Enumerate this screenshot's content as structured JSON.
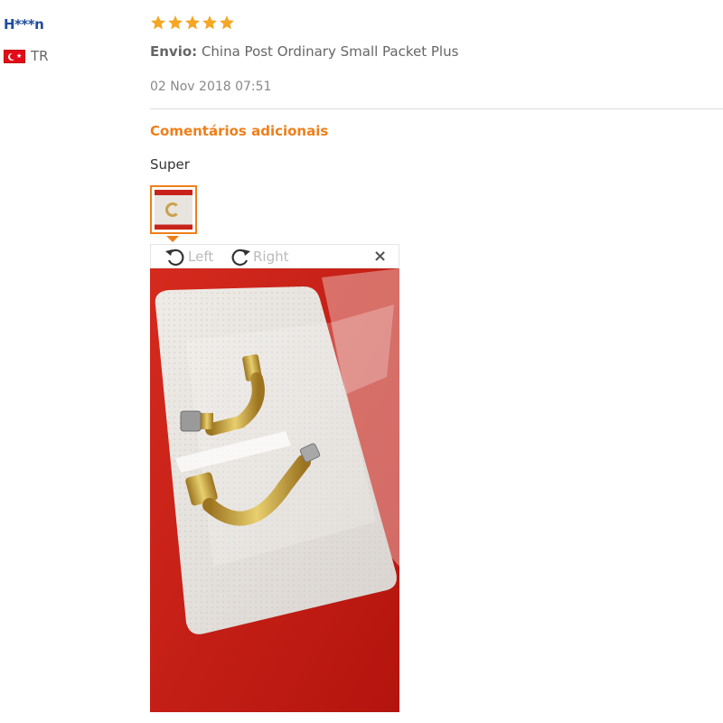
{
  "reviewer": {
    "name": "H***n",
    "country_code": "TR",
    "flag": "turkey-flag"
  },
  "review": {
    "rating": 5,
    "rating_max": 5,
    "star_color": "#f5a623",
    "shipping_label": "Envio:",
    "shipping_method": "China Post Ordinary Small Packet Plus",
    "date": "02 Nov 2018 07:51",
    "comments_heading": "Comentários adicionais",
    "comment": "Super"
  },
  "image_viewer": {
    "rotate_left_label": "Left",
    "rotate_right_label": "Right",
    "close_label": "×"
  },
  "colors": {
    "accent": "#ef7f1a",
    "username": "#1f4c9c"
  }
}
